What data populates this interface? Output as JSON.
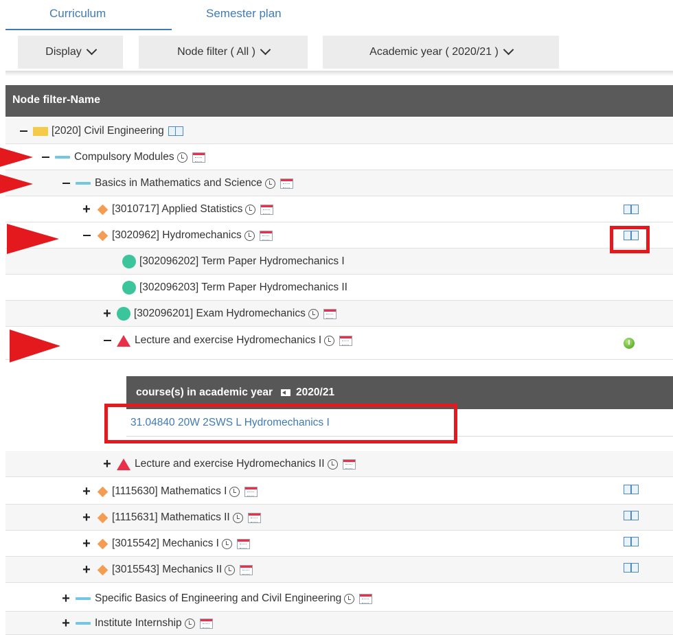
{
  "tabs": [
    {
      "label": "Curriculum",
      "active": true
    },
    {
      "label": "Semester plan",
      "active": false
    }
  ],
  "filters": {
    "display": "Display",
    "node_filter": "Node filter ( All )",
    "academic_year": "Academic year ( 2020/21 )"
  },
  "table": {
    "header": "Node filter-Name",
    "rows": [
      {
        "toggle": "-",
        "icon": "folder-icon",
        "label": "[2020] Civil Engineering"
      },
      {
        "toggle": "-",
        "icon": "module-icon",
        "label": "Compulsory Modules"
      },
      {
        "toggle": "-",
        "icon": "module-icon",
        "label": "Basics in Mathematics and Science"
      },
      {
        "toggle": "+",
        "icon": "diamond-icon",
        "label": "[3010717] Applied Statistics"
      },
      {
        "toggle": "-",
        "icon": "diamond-icon",
        "label": "[3020962] Hydromechanics"
      },
      {
        "toggle": "",
        "icon": "circle-icon",
        "label": "[302096202] Term Paper Hydromechanics I"
      },
      {
        "toggle": "",
        "icon": "circle-icon",
        "label": "[302096203] Term Paper Hydromechanics II"
      },
      {
        "toggle": "+",
        "icon": "circle-icon",
        "label": "[302096201] Exam Hydromechanics"
      },
      {
        "toggle": "-",
        "icon": "triangle-icon",
        "label": "Lecture and exercise Hydromechanics I"
      },
      {
        "toggle": "+",
        "icon": "triangle-icon",
        "label": "Lecture and exercise Hydromechanics II"
      },
      {
        "toggle": "+",
        "icon": "diamond-icon",
        "label": "[1115630] Mathematics I"
      },
      {
        "toggle": "+",
        "icon": "diamond-icon",
        "label": "[1115631] Mathematics II"
      },
      {
        "toggle": "+",
        "icon": "diamond-icon",
        "label": "[3015542] Mechanics I"
      },
      {
        "toggle": "+",
        "icon": "diamond-icon",
        "label": "[3015543] Mechanics II"
      },
      {
        "toggle": "+",
        "icon": "module-icon",
        "label": "Specific Basics of Engineering and Civil Engineering"
      },
      {
        "toggle": "+",
        "icon": "module-icon",
        "label": "Institute Internship"
      }
    ]
  },
  "course_panel": {
    "header_label": "course(s) in academic year",
    "year": "2020/21",
    "course_link": "31.04840 20W 2SWS L Hydromechanics I"
  },
  "colors": {
    "accent": "#3f7ab5",
    "annotation_red": "#e3191e",
    "header_bg": "#5a5a5a"
  }
}
